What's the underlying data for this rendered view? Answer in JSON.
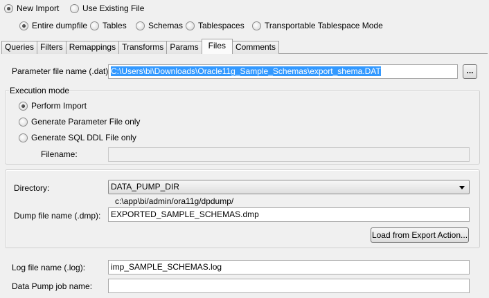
{
  "import_mode": {
    "options": [
      {
        "label": "New Import",
        "checked": true
      },
      {
        "label": "Use Existing File",
        "checked": false
      }
    ]
  },
  "scope": {
    "options": [
      {
        "label": "Entire dumpfile",
        "checked": true
      },
      {
        "label": "Tables",
        "checked": false
      },
      {
        "label": "Schemas",
        "checked": false
      },
      {
        "label": "Tablespaces",
        "checked": false
      },
      {
        "label": "Transportable Tablespace Mode",
        "checked": false
      }
    ]
  },
  "tabs": [
    {
      "label": "Queries",
      "active": false
    },
    {
      "label": "Filters",
      "active": false
    },
    {
      "label": "Remappings",
      "active": false
    },
    {
      "label": "Transforms",
      "active": false
    },
    {
      "label": "Params",
      "active": false
    },
    {
      "label": "Files",
      "active": true
    },
    {
      "label": "Comments",
      "active": false
    }
  ],
  "parameter_file": {
    "label": "Parameter file name (.dat):",
    "value": "C:\\Users\\bi\\Downloads\\Oracle11g_Sample_Schemas\\export_shema.DAT",
    "browse_label": "..."
  },
  "execution_mode": {
    "title": "Execution mode",
    "options": [
      {
        "label": "Perform Import",
        "checked": true
      },
      {
        "label": "Generate Parameter File only",
        "checked": false
      },
      {
        "label": "Generate SQL DDL File only",
        "checked": false
      }
    ],
    "filename_label": "Filename:",
    "filename_value": ""
  },
  "directory": {
    "label": "Directory:",
    "value": "DATA_PUMP_DIR",
    "path": "c:\\app\\bi/admin/ora11g/dpdump/"
  },
  "dump_file": {
    "label": "Dump file name (.dmp):",
    "value": "EXPORTED_SAMPLE_SCHEMAS.dmp",
    "load_button": "Load from Export Action..."
  },
  "log_file": {
    "label": "Log file name (.log):",
    "value": "imp_SAMPLE_SCHEMAS.log"
  },
  "job_name": {
    "label": "Data Pump job name:",
    "value": ""
  }
}
